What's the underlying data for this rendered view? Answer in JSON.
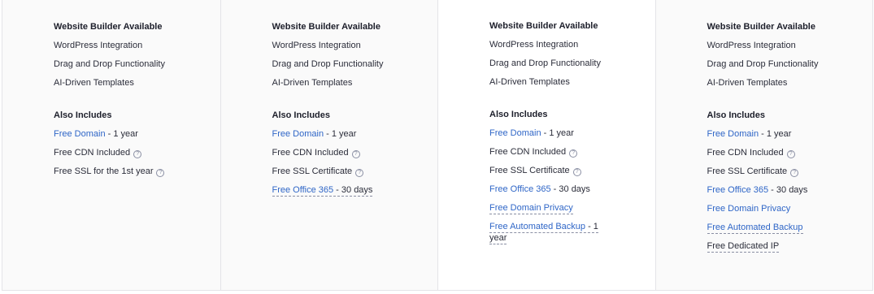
{
  "plans": [
    {
      "features": [
        "Website Builder Available",
        "WordPress Integration",
        "Drag and Drop Functionality",
        "AI-Driven Templates"
      ],
      "also_includes_heading": "Also Includes",
      "includes": [
        {
          "link": "Free Domain",
          "suffix": " - 1 year"
        },
        {
          "text": "Free CDN Included",
          "icon": "help-circle-icon"
        },
        {
          "text": "Free SSL for the 1st year",
          "icon": "help-circle-icon"
        }
      ]
    },
    {
      "features": [
        "Website Builder Available",
        "WordPress Integration",
        "Drag and Drop Functionality",
        "AI-Driven Templates"
      ],
      "also_includes_heading": "Also Includes",
      "includes": [
        {
          "link": "Free Domain",
          "suffix": " - 1 year"
        },
        {
          "text": "Free CDN Included",
          "icon": "help-circle-icon"
        },
        {
          "text": "Free SSL Certificate",
          "icon": "help-circle-icon"
        },
        {
          "link": "Free Office 365",
          "suffix": " - 30 days"
        }
      ]
    },
    {
      "features": [
        "Website Builder Available",
        "WordPress Integration",
        "Drag and Drop Functionality",
        "AI-Driven Templates"
      ],
      "also_includes_heading": "Also Includes",
      "includes": [
        {
          "link": "Free Domain",
          "suffix": " - 1 year"
        },
        {
          "text": "Free CDN Included",
          "icon": "help-circle-icon"
        },
        {
          "text": "Free SSL Certificate",
          "icon": "help-circle-icon"
        },
        {
          "link": "Free Office 365",
          "suffix": " - 30 days"
        },
        {
          "link": "Free Domain Privacy"
        },
        {
          "link": "Free Automated Backup",
          "suffix": " - 1 year"
        }
      ]
    },
    {
      "features": [
        "Website Builder Available",
        "WordPress Integration",
        "Drag and Drop Functionality",
        "AI-Driven Templates"
      ],
      "also_includes_heading": "Also Includes",
      "includes": [
        {
          "link": "Free Domain",
          "suffix": " - 1 year"
        },
        {
          "text": "Free CDN Included",
          "icon": "help-circle-icon"
        },
        {
          "text": "Free SSL Certificate",
          "icon": "help-circle-icon"
        },
        {
          "link": "Free Office 365",
          "suffix": " - 30 days"
        },
        {
          "link": "Free Domain Privacy"
        },
        {
          "link": "Free Automated Backup"
        },
        {
          "text": "Free Dedicated IP"
        }
      ]
    }
  ],
  "colors": {
    "link": "#2f66c7",
    "text": "#2b2d3a",
    "panel": "#fafafa",
    "featured_panel": "#ffffff"
  }
}
